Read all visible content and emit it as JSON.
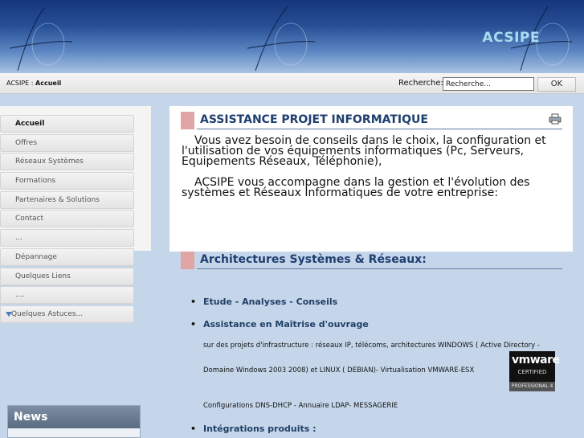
{
  "header": {
    "site_name": "ACSIPE"
  },
  "toolbar": {
    "breadcrumb_root": "ACSIPE : ",
    "breadcrumb_current": "Accueil",
    "search_label": "Recherche:",
    "search_value": "Recherche...",
    "ok_label": "OK"
  },
  "sidebar": {
    "items": [
      {
        "label": "Accueil"
      },
      {
        "label": "Offres"
      },
      {
        "label": "Réseaux Systèmes"
      },
      {
        "label": "Formations"
      },
      {
        "label": "Partenaires & Solutions"
      },
      {
        "label": "Contact"
      },
      {
        "label": "..."
      },
      {
        "label": "Dépannage"
      },
      {
        "label": "Quelques Liens"
      },
      {
        "label": "...."
      },
      {
        "label": "Quelques Astuces..."
      }
    ],
    "news_title": "News"
  },
  "main": {
    "section1_title": "ASSISTANCE PROJET INFORMATIQUE",
    "para1": "Vous avez besoin de conseils dans le choix, la configuration et l'utilisation de vos équipements informatiques (Pc, Serveurs, Equipements Réseaux, Téléphonie),",
    "para2": "ACSIPE    vous accompagne dans la gestion et l'évolution des systèmes et Réseaux Informatiques de votre entreprise:",
    "section2_title": "Architectures Systèmes & Réseaux:",
    "bullet1": "Etude -  Analyses - Conseils",
    "bullet2": "Assistance en Maîtrise d'ouvrage",
    "detail1": "sur des projets d'infrastructure : réseaux IP, télécoms, architectures WINDOWS  ( Active Directory -",
    "detail2": "Domaine Windows 2003 2008) et LINUX ( DEBIAN)- Virtualisation VMWARE-ESX",
    "detail3": "Configurations DNS-DHCP - Annuaire LDAP- MESSAGERIE",
    "bullet3": "Intégrations produits :"
  },
  "vmware_badge": {
    "brand": "vmware",
    "certified": "CERTIFIED",
    "level": "PROFESSIONAL 4"
  }
}
